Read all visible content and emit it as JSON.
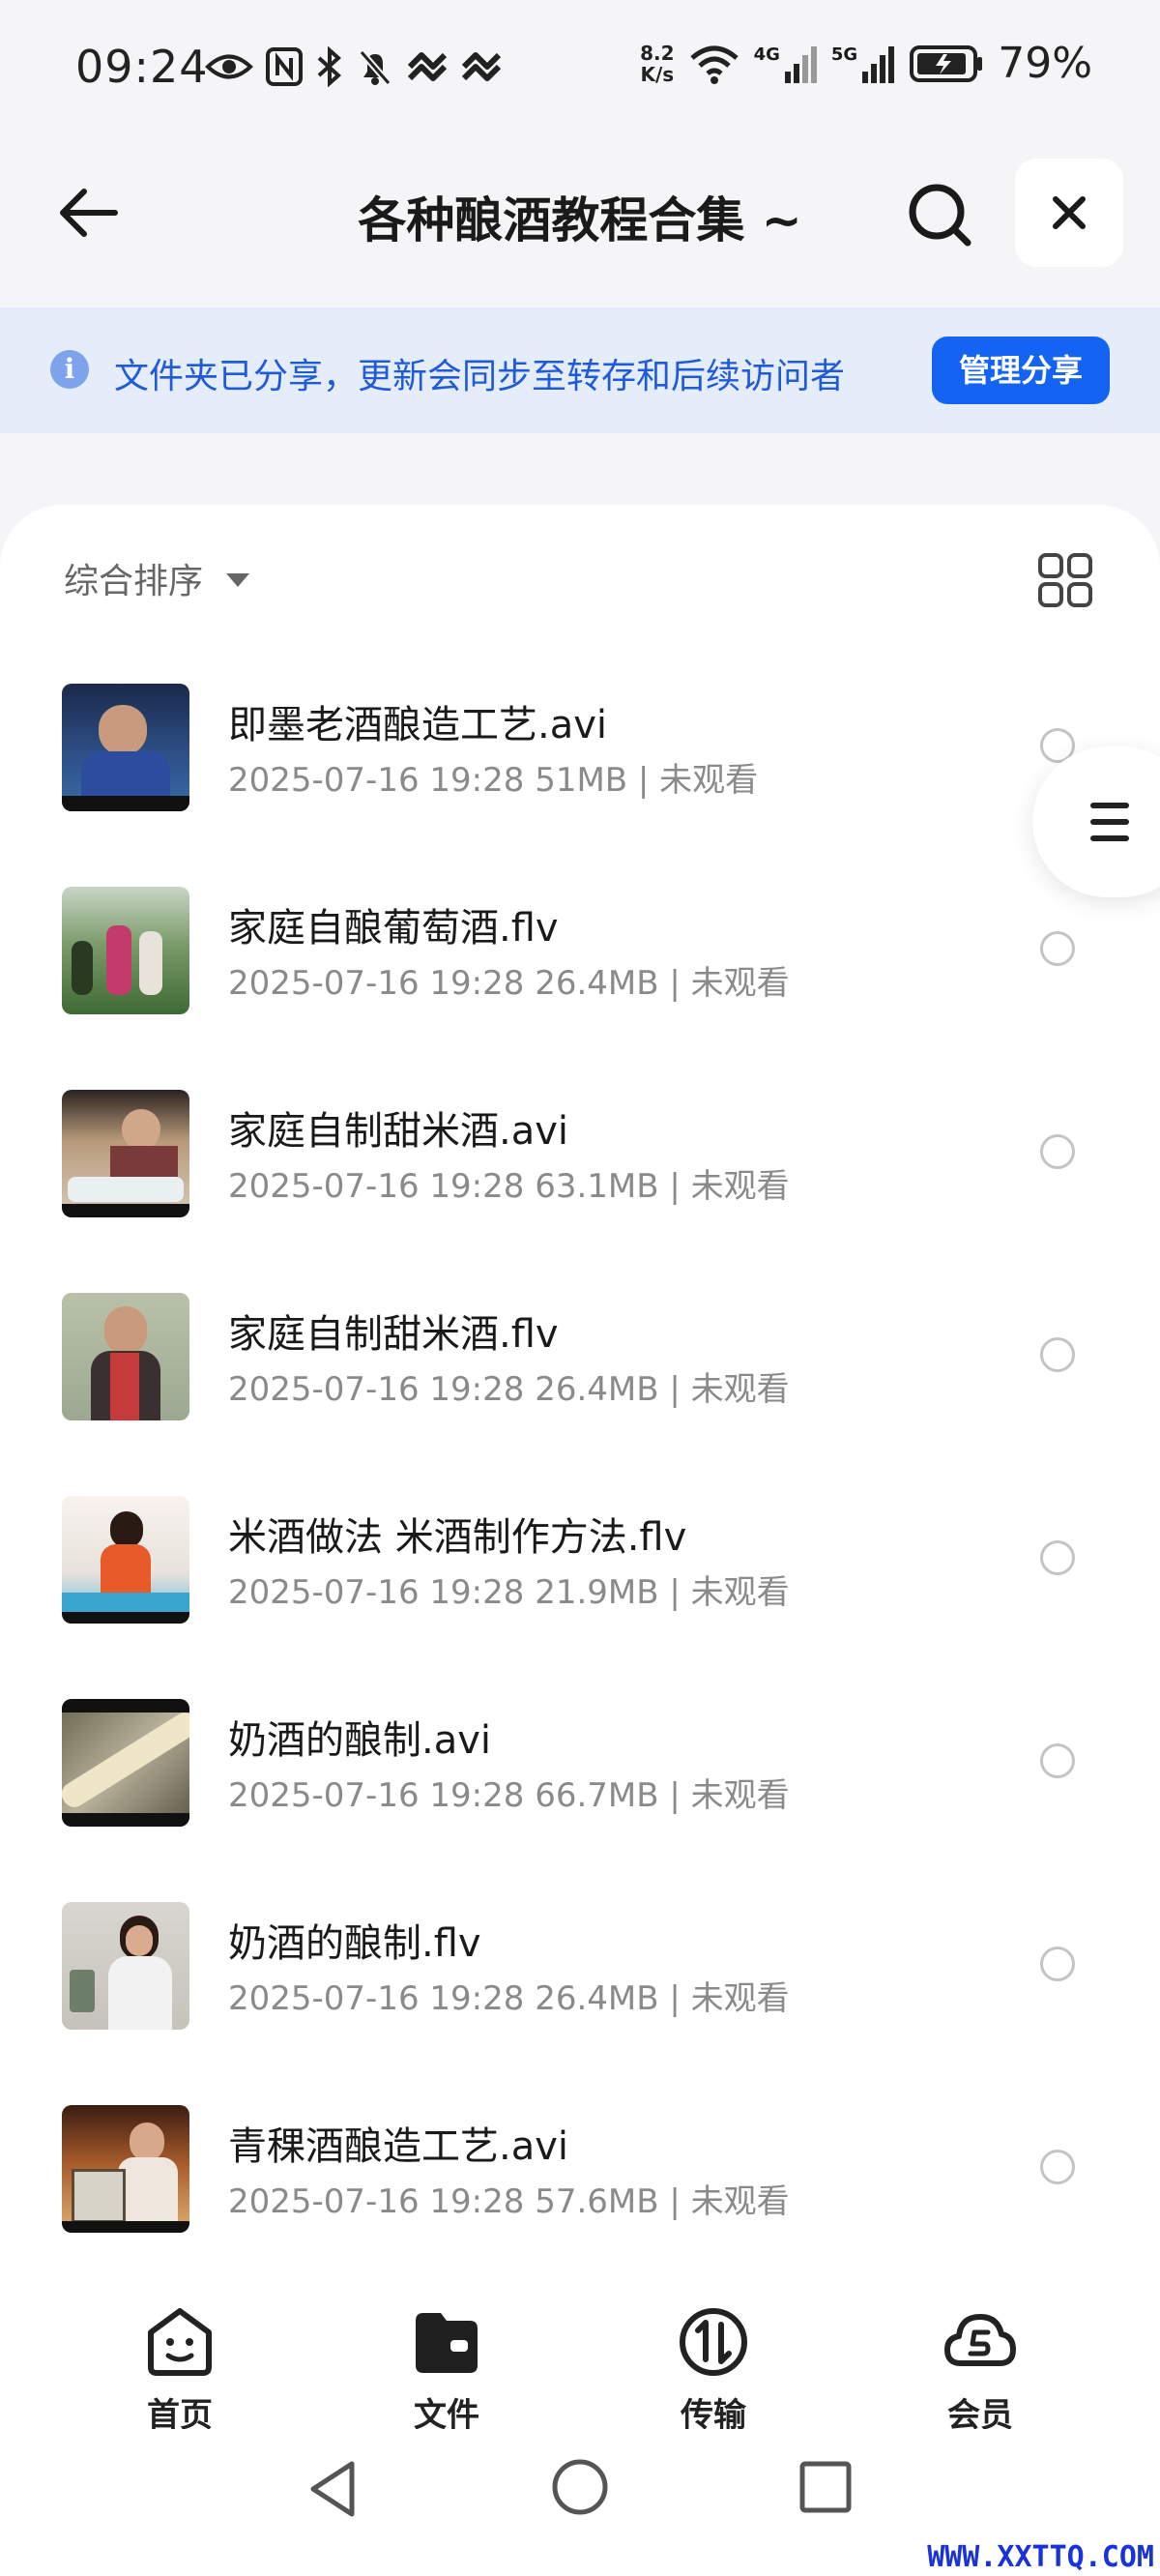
{
  "status_bar": {
    "time": "09:24",
    "speed_top": "8.2",
    "speed_bottom": "K/s",
    "net1": "4G",
    "net2": "5G",
    "battery": "79%"
  },
  "header": {
    "title": "各种酿酒教程合集 ~"
  },
  "notice": {
    "text": "文件夹已分享，更新会同步至转存和后续访问者",
    "button": "管理分享"
  },
  "sort": {
    "label": "综合排序"
  },
  "files": [
    {
      "name": "即墨老酒酿造工艺.avi",
      "meta": "2025-07-16 19:28  51MB | 未观看"
    },
    {
      "name": "家庭自酿葡萄酒.flv",
      "meta": "2025-07-16 19:28  26.4MB | 未观看"
    },
    {
      "name": "家庭自制甜米酒.avi",
      "meta": "2025-07-16 19:28  63.1MB | 未观看"
    },
    {
      "name": "家庭自制甜米酒.flv",
      "meta": "2025-07-16 19:28  26.4MB | 未观看"
    },
    {
      "name": "米酒做法 米酒制作方法.flv",
      "meta": "2025-07-16 19:28  21.9MB | 未观看"
    },
    {
      "name": "奶酒的酿制.avi",
      "meta": "2025-07-16 19:28  66.7MB | 未观看"
    },
    {
      "name": "奶酒的酿制.flv",
      "meta": "2025-07-16 19:28  26.4MB | 未观看"
    },
    {
      "name": "青稞酒酿造工艺.avi",
      "meta": "2025-07-16 19:28  57.6MB | 未观看"
    }
  ],
  "tabs": [
    {
      "label": "首页",
      "icon": "home-smile-icon"
    },
    {
      "label": "文件",
      "icon": "folder-icon"
    },
    {
      "label": "传输",
      "icon": "transfer-icon"
    },
    {
      "label": "会员",
      "icon": "vip-cloud-icon"
    }
  ],
  "watermark": "WWW.XXTTQ.COM",
  "colors": {
    "accent": "#1463f2",
    "notice_bg": "#e6edfa",
    "notice_text": "#1f5ad9"
  }
}
